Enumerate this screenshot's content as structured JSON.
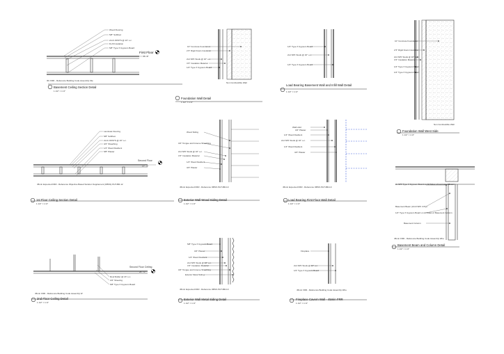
{
  "details": {
    "basement_ceiling_section": {
      "labels": [
        "Wood Flooring",
        "5/8\" Subfloor",
        "2x10 JOISTS @ 16\" o.c.",
        "R-20 Insulation",
        "5/8\" Type X Gypsum Board"
      ],
      "level": "First Floor",
      "level_elev": "8' - 0\"",
      "note": "3hr FRR - Reference Building Code Assembly File",
      "title": "Basement Ceiling Section Detail",
      "scale": "1 1/2\" = 1'-0\""
    },
    "foundation_wall": {
      "labels": [
        "10\" Concrete Foundation",
        "2.5\" Rigid Foam Insulation",
        "2x4 SPF Studs @ 16\" o.c.",
        "3.5\" Insulation Material",
        "1/2\" Type X Gypsum Board"
      ],
      "note": "Non Combustible Wall",
      "title": "Foundation Wall Detail",
      "scale": "1 1/2\" = 1'-0\""
    },
    "load_bearing_basement_wall": {
      "labels": [
        "1/2\" Type X Gypsum Board",
        "2x4 SPF Studs @ 16\" o.c.",
        "1/2\" Type X Gypsum Board"
      ],
      "title": "Load Bearing Basement Wall and Infill Wall Detail",
      "scale": "1 1/2\" = 1'-0\""
    },
    "foundation_wall_west": {
      "labels": [
        "10\" Concrete Foundation",
        "2.5\" Rigid Foam Insulation",
        "2x4 SPF Studs @ 16\" o.c.",
        "3.5\" Insulation Material",
        "1/2\" Type X Gypsum Board",
        "1/2\" Type X Gypsum Board"
      ],
      "note": "Non Combustible Wall",
      "title": "Foundation Wall West Side",
      "scale": "1 1/2\" = 1'-0\""
    },
    "first_floor_ceiling_section": {
      "labels": [
        "Laminate Flooring",
        "5/8\" Subfloor",
        "2x10 JOISTS @ 16\" o.c.",
        "3/4\" Sheathing",
        "1/4\" Wood Resilient",
        "5/8\" Plaster"
      ],
      "level": "Second Floor",
      "level_elev": "17' - 0\"",
      "note": "45min Expected FRR - Reference Objective Based Solution Supplement (OBSS) PHT-BR-12",
      "title": "1st Floor Ceiling Section Detail",
      "scale": "1 1/2\" = 1'-0\""
    },
    "exterior_wall_wood_siding": {
      "labels": [
        "Wood Siding",
        "3/4\" Tongue and Groove Sheathing",
        "2x4 SPF Studs @ 16\" o.c.",
        "3.5\" Insulation Material",
        "1/4\" Wood Resilient",
        "3/4\" Plaster"
      ],
      "note": "45min Expected FRR - Reference OBSS PHT-BR-10",
      "title": "Exterior Wall Wood Siding Detail",
      "scale": "1 1/2\" = 1'-0\""
    },
    "load_bearing_first_floor_wall": {
      "labels": [
        "Wall Hold",
        "3/4\" Plaster",
        "1/4\" Wood Resilient",
        "2x4 SPF Studs @ 16\" o.c.",
        "1/4\" Wood Resilient",
        "3/4\" Plaster"
      ],
      "note": "45min Expected FRR - Reference OBSS PHT-BR-10",
      "title": "Load Bearing First Floor Wall Detail",
      "scale": "1 1/2\" = 1'-0\""
    },
    "basement_beam_column": {
      "labels": [
        "2x SPF Type X Gypsum Board on All Sides of Laminated Beam",
        "Basement Beam (2x10 SPF 3 Ply)",
        "1/2\" Type X Gypsum Board on All Sides of Basement Column",
        "Basement Column"
      ],
      "note": "45min FRR - Reference Building Code Assembly Wire",
      "title": "Basement Beam and Column Detail",
      "scale": "1 1/2\" = 1'-0\""
    },
    "second_floor_ceiling": {
      "labels": [
        "Roof Rafter @ 16\" o.c.",
        "3/4\" Sheeting",
        "5/8\" Type X Gypsum Board"
      ],
      "level": "Second Floor Ceiling",
      "level_elev": "25' - 0\"",
      "note": "45min FRR - Reference Building Code Assembly W",
      "title": "2nd Floor Ceiling Detail",
      "scale": "1 1/2\" = 1'-0\""
    },
    "exterior_wall_metal_siding": {
      "labels": [
        "5/8\" Type X Gypsum Board",
        "3/4\" Plaster",
        "1/4\" Wood Resilient",
        "2x4 SPF Studs @ 16\" o.c.",
        "3.5\" Insulation Material",
        "3/4\" Tongue and Groove Sheathing",
        "Exterior Metal Siding"
      ],
      "note": "45min Expected FRR - Reference OBSS PHT-BR-10",
      "title": "Exterior Wall Metal Siding Detail",
      "scale": "1 1/2\" = 1'-0\""
    },
    "fireplace_cavern_wall": {
      "labels": [
        "Fireplace",
        "2x4 SPF Studs @ 16\" o.c.",
        "1/2\" Type X Gypsum Board"
      ],
      "note": "45min FRR - Reference Building Code Assembly Wire",
      "title": "Fireplace Cavern Wall - 45min FRR",
      "scale": "1 1/2\" = 1'-0\""
    }
  }
}
